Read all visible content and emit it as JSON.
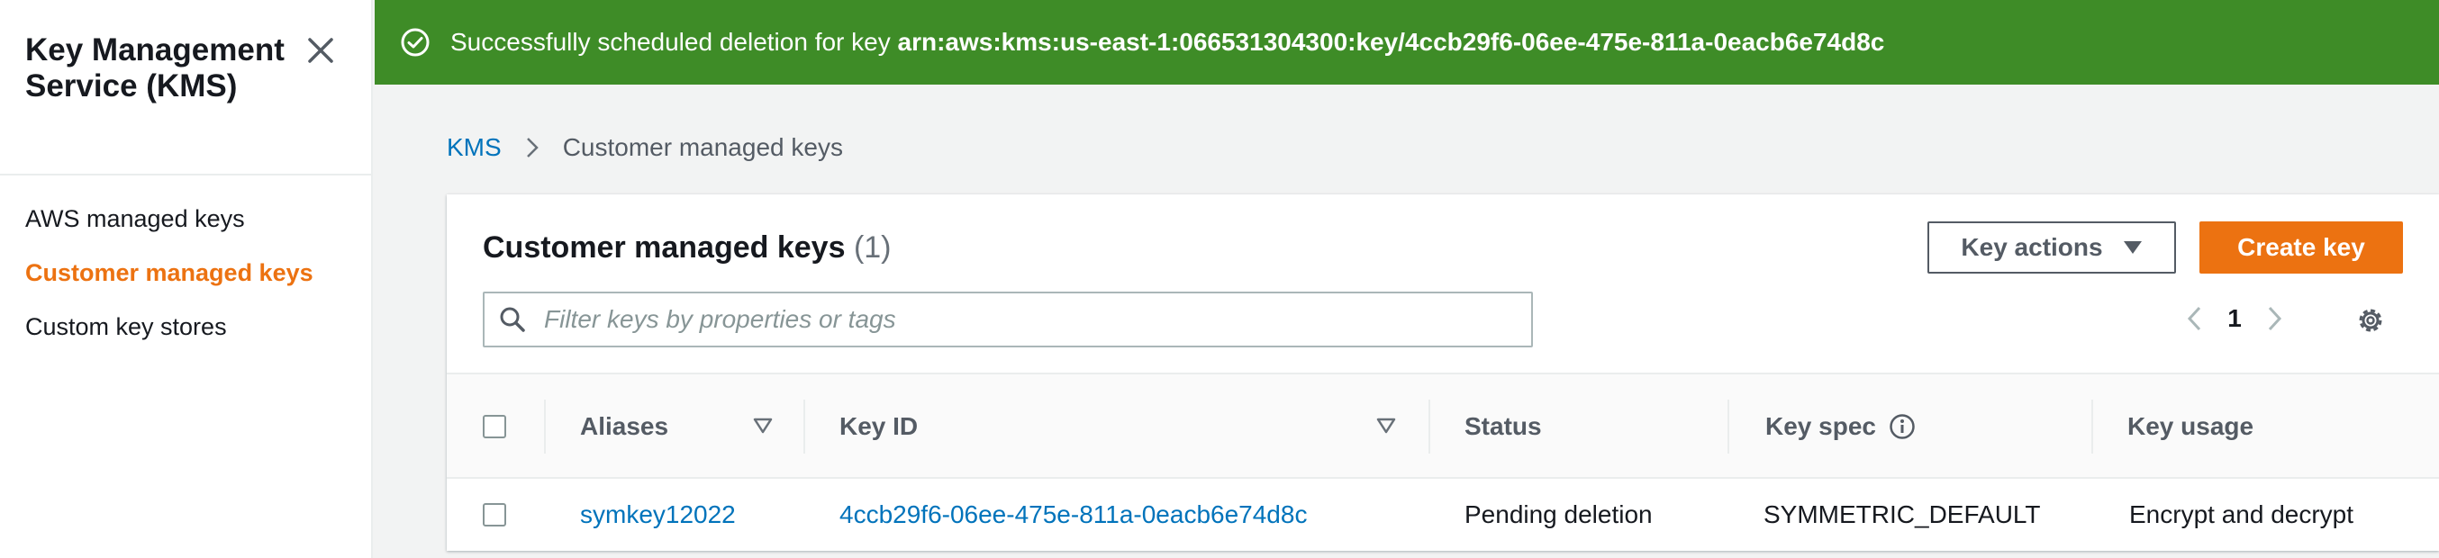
{
  "sidebar": {
    "title": "Key Management Service (KMS)",
    "items": [
      {
        "label": "AWS managed keys",
        "active": false
      },
      {
        "label": "Customer managed keys",
        "active": true
      },
      {
        "label": "Custom key stores",
        "active": false
      }
    ]
  },
  "flash": {
    "message": "Successfully scheduled deletion for key",
    "key_arn": "arn:aws:kms:us-east-1:066531304300:key/4ccb29f6-06ee-475e-811a-0eacb6e74d8c",
    "icon": "success-check-icon",
    "color": "#3e8c27"
  },
  "breadcrumb": {
    "root": "KMS",
    "current": "Customer managed keys"
  },
  "panel": {
    "title": "Customer managed keys",
    "count": "(1)",
    "key_actions_label": "Key actions",
    "create_key_label": "Create key",
    "search_placeholder": "Filter keys by properties or tags",
    "page": "1"
  },
  "table": {
    "columns": [
      "Aliases",
      "Key ID",
      "Status",
      "Key spec",
      "Key usage"
    ],
    "rows": [
      {
        "alias": "symkey12022",
        "key_id": "4ccb29f6-06ee-475e-811a-0eacb6e74d8c",
        "status": "Pending deletion",
        "key_spec": "SYMMETRIC_DEFAULT",
        "key_usage": "Encrypt and decrypt"
      }
    ]
  },
  "colors": {
    "accent": "#ec7211",
    "link": "#0073bb",
    "success": "#3e8c27"
  }
}
